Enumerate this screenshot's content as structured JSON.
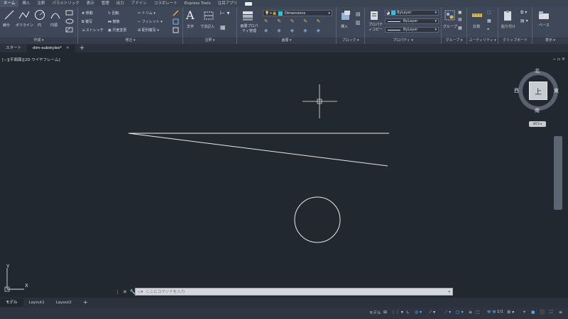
{
  "menubar": {
    "tabs": [
      "ホーム",
      "挿入",
      "注釈",
      "パラメトリック",
      "表示",
      "管理",
      "出力",
      "アドイン",
      "コラボレート",
      "Express Tools",
      "注目アプリ"
    ]
  },
  "ribbon": {
    "draw": {
      "title": "作成 ▾",
      "line": "線分",
      "polyline": "ポリライン",
      "circle": "円",
      "arc": "円弧"
    },
    "modify": {
      "title": "修正 ▾",
      "move": "移動",
      "rotate": "回転",
      "trim": "トリム",
      "copy": "複写",
      "mirror": "鏡像",
      "fillet": "フィレット",
      "stretch": "ストレッチ",
      "scale": "尺度変更",
      "array": "配列複写"
    },
    "annotation": {
      "title": "注釈 ▾",
      "text": "文字",
      "dimension": "寸法記入"
    },
    "layers": {
      "title": "画層 ▾",
      "properties": "画層プロパティ管理",
      "current_layer": "Dimensions"
    },
    "block": {
      "title": "ブロック ▾",
      "insert": "挿入"
    },
    "properties": {
      "title": "プロパティ ▾",
      "match": "プロパティコピー",
      "color": "ByLayer",
      "linetype": "ByLayer",
      "lineweight": "ByLayer"
    },
    "groups": {
      "title": "グループ ▾",
      "group": "グループ"
    },
    "utilities": {
      "title": "ユーティリティ ▾",
      "measure": "計測"
    },
    "clipboard": {
      "title": "クリップボード",
      "paste": "貼り付け"
    },
    "view": {
      "title": "表示 ▾",
      "base": "ベース"
    }
  },
  "doctabs": {
    "start": "スタート",
    "file": "dim-substyles*"
  },
  "viewport": {
    "label": "[−][平面図][2D ワイヤフレーム]",
    "viewcube": {
      "north": "北",
      "south": "南",
      "east": "東",
      "west": "西",
      "top": "上",
      "wcs": "WCS"
    },
    "ucs": {
      "x": "X",
      "y": "Y"
    }
  },
  "command": {
    "placeholder": "ここにコマンドを入力"
  },
  "layouttabs": [
    "モデル",
    "Layout1",
    "Layout2"
  ],
  "statusbar": {
    "model": "モデル",
    "scale": "1/1"
  },
  "colors": {
    "layer_swatch": "#22c7e6",
    "property_swatch": "#22c7e6",
    "background": "#212830",
    "accent": "#3a86d6"
  }
}
